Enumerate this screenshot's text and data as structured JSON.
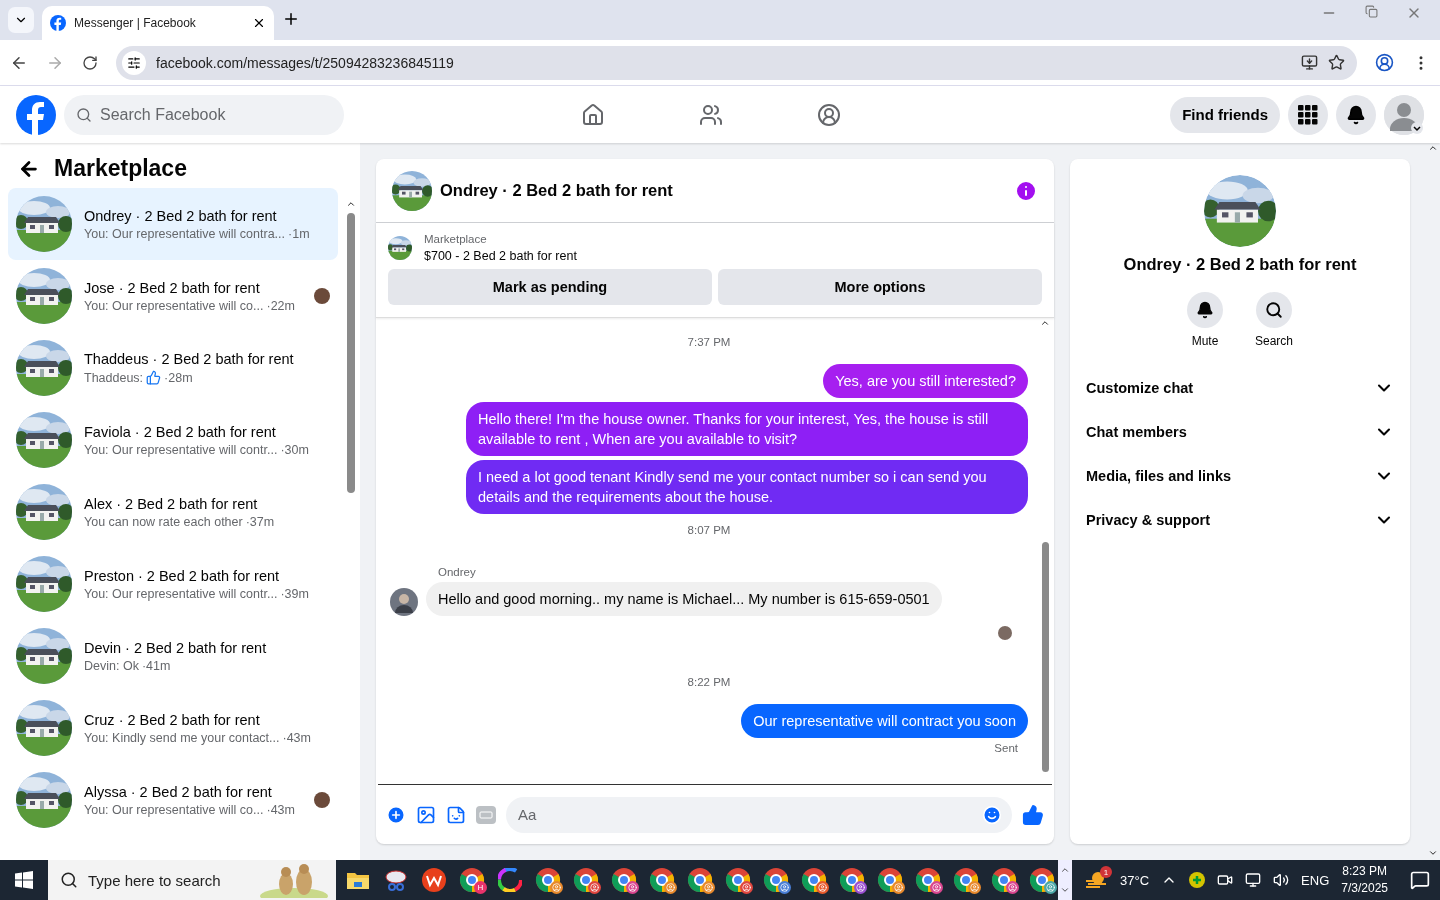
{
  "browser": {
    "tab_title": "Messenger | Facebook",
    "url": "facebook.com/messages/t/25094283236845119"
  },
  "header": {
    "search_placeholder": "Search Facebook",
    "find_friends": "Find friends"
  },
  "marketplace": {
    "title": "Marketplace",
    "conversations": [
      {
        "title": "Ondrey · 2 Bed 2 bath for rent",
        "preview": "You: Our representative will contra...",
        "time": "·1m",
        "selected": true,
        "seen": false,
        "kind": "text"
      },
      {
        "title": "Jose · 2 Bed 2 bath for rent",
        "preview": "You: Our representative will co...",
        "time": "·22m",
        "selected": false,
        "seen": true,
        "kind": "text"
      },
      {
        "title": "Thaddeus · 2 Bed 2 bath for rent",
        "preview": "Thaddeus:",
        "time": "·28m",
        "selected": false,
        "seen": false,
        "kind": "like"
      },
      {
        "title": "Faviola · 2 Bed 2 bath for rent",
        "preview": "You: Our representative will contr...",
        "time": "·30m",
        "selected": false,
        "seen": false,
        "kind": "text"
      },
      {
        "title": "Alex · 2 Bed 2 bath for rent",
        "preview": "You can now rate each other",
        "time": "·37m",
        "selected": false,
        "seen": false,
        "kind": "text"
      },
      {
        "title": "Preston · 2 Bed 2 bath for rent",
        "preview": "You: Our representative will contr...",
        "time": "·39m",
        "selected": false,
        "seen": false,
        "kind": "text"
      },
      {
        "title": "Devin · 2 Bed 2 bath for rent",
        "preview": "Devin: Ok",
        "time": "·41m",
        "selected": false,
        "seen": false,
        "kind": "text"
      },
      {
        "title": "Cruz · 2 Bed 2 bath for rent",
        "preview": "You: Kindly send me your contact...",
        "time": "·43m",
        "selected": false,
        "seen": false,
        "kind": "text"
      },
      {
        "title": "Alyssa · 2 Bed 2 bath for rent",
        "preview": "You: Our representative will co...",
        "time": "·43m",
        "selected": false,
        "seen": true,
        "kind": "text"
      }
    ]
  },
  "chat": {
    "title": "Ondrey · 2 Bed 2 bath for rent",
    "listing_label": "Marketplace",
    "listing": "$700 - 2 Bed 2 bath for rent",
    "buttons": [
      "Mark as pending",
      "More options"
    ],
    "messages": [
      {
        "kind": "time",
        "text": "7:37 PM"
      },
      {
        "kind": "out",
        "text": "Yes, are you still interested?",
        "color": "#a61ff0"
      },
      {
        "kind": "out",
        "text": "Hello there! I'm the house owner. Thanks for your interest, Yes, the house is still available to rent , When are you available to visit?",
        "color": "#8e1ff5"
      },
      {
        "kind": "out",
        "text": "I need a lot good tenant Kindly send me your contact number so i can send you details and the requirements about the house.",
        "color": "#702bf3"
      },
      {
        "kind": "time",
        "text": "8:07 PM"
      },
      {
        "kind": "in",
        "sender": "Ondrey",
        "text": "Hello and good morning.. my name is Michael... My number is 615-659-0501"
      },
      {
        "kind": "seen"
      },
      {
        "kind": "time",
        "text": "8:22 PM"
      },
      {
        "kind": "out",
        "text": "Our representative will contract you soon",
        "color": "#0866ff"
      },
      {
        "kind": "status",
        "text": "Sent"
      }
    ],
    "composer_placeholder": "Aa"
  },
  "details": {
    "name": "Ondrey · 2 Bed 2 bath for rent",
    "actions": [
      "Mute",
      "Search"
    ],
    "sections": [
      "Customize chat",
      "Chat members",
      "Media, files and links",
      "Privacy & support"
    ]
  },
  "taskbar": {
    "search_placeholder": "Type here to search",
    "apps": [
      {
        "kind": "folder"
      },
      {
        "kind": "snip"
      },
      {
        "kind": "office"
      },
      {
        "kind": "chrome",
        "badge": "H",
        "color": "#e8336b"
      },
      {
        "kind": "wheel"
      },
      {
        "kind": "chrome",
        "color": "#e8892c"
      },
      {
        "kind": "chrome",
        "color": "#e0463f"
      },
      {
        "kind": "chrome",
        "color": "#d9468f"
      },
      {
        "kind": "chrome",
        "color": "#e8892c"
      },
      {
        "kind": "chrome",
        "color": "#e8892c"
      },
      {
        "kind": "chrome",
        "color": "#e0463f"
      },
      {
        "kind": "chrome",
        "color": "#4a7fd6"
      },
      {
        "kind": "chrome",
        "color": "#e85a2c"
      },
      {
        "kind": "chrome",
        "color": "#9a4fd0"
      },
      {
        "kind": "chrome",
        "color": "#e8892c"
      },
      {
        "kind": "chrome",
        "color": "#d9468f"
      },
      {
        "kind": "chrome",
        "color": "#e8892c"
      },
      {
        "kind": "chrome",
        "color": "#d9468f"
      },
      {
        "kind": "chrome",
        "color": "#4aa7a8"
      }
    ],
    "weather": "37°C",
    "weather_badge": "1",
    "language": "ENG",
    "time": "8:23 PM",
    "date": "7/3/2025"
  }
}
